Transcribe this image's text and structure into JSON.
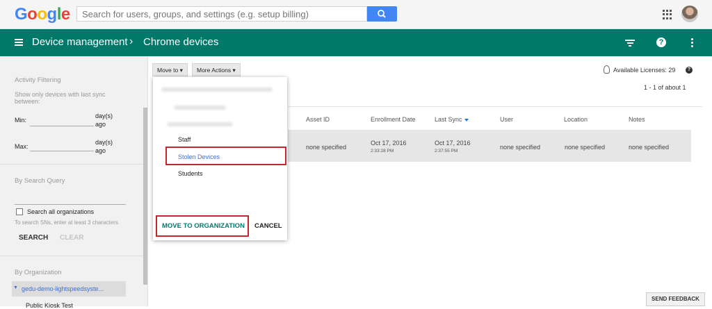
{
  "header": {
    "logo": "Google",
    "search_placeholder": "Search for users, groups, and settings (e.g. setup billing)"
  },
  "nav": {
    "breadcrumb_1": "Device management",
    "breadcrumb_sep": "›",
    "breadcrumb_2": "Chrome devices"
  },
  "sidebar": {
    "activity_heading": "Activity Filtering",
    "activity_desc": "Show only devices with last sync between:",
    "min_label": "Min:",
    "max_label": "Max:",
    "days_ago_1": "day(s)",
    "ago_1": "ago",
    "days_ago_2": "day(s)",
    "ago_2": "ago",
    "search_query_heading": "By Search Query",
    "search_all_orgs": "Search all organizations",
    "search_hint": "To search SNs, enter at least 3 characters",
    "search_btn": "SEARCH",
    "clear_btn": "CLEAR",
    "by_org_heading": "By Organization",
    "org_root": "gedu-demo-lightspeedsyste...",
    "org_child": "Public Kiosk Test"
  },
  "toolbar": {
    "move_to": "Move to",
    "more_actions": "More Actions",
    "licenses": "Available Licenses: 29",
    "paging": "1 - 1 of about 1"
  },
  "table": {
    "headers": {
      "asset_id": "Asset ID",
      "enrollment_date": "Enrollment Date",
      "last_sync": "Last Sync",
      "user": "User",
      "location": "Location",
      "notes": "Notes"
    },
    "row": {
      "asset_id": "none specified",
      "enroll_date": "Oct 17, 2016",
      "enroll_time": "2:33:28 PM",
      "sync_date": "Oct 17, 2016",
      "sync_time": "2:37:55 PM",
      "user": "none specified",
      "location": "none specified",
      "notes": "none specified"
    }
  },
  "dropdown": {
    "items": [
      "Staff",
      "Stolen Devices",
      "Students"
    ],
    "move_btn": "MOVE TO ORGANIZATION",
    "cancel_btn": "CANCEL"
  },
  "footer": {
    "feedback": "SEND FEEDBACK"
  },
  "colors": {
    "brand_green": "#00796b",
    "highlight_red": "#c6262b",
    "search_blue": "#4285f4"
  }
}
